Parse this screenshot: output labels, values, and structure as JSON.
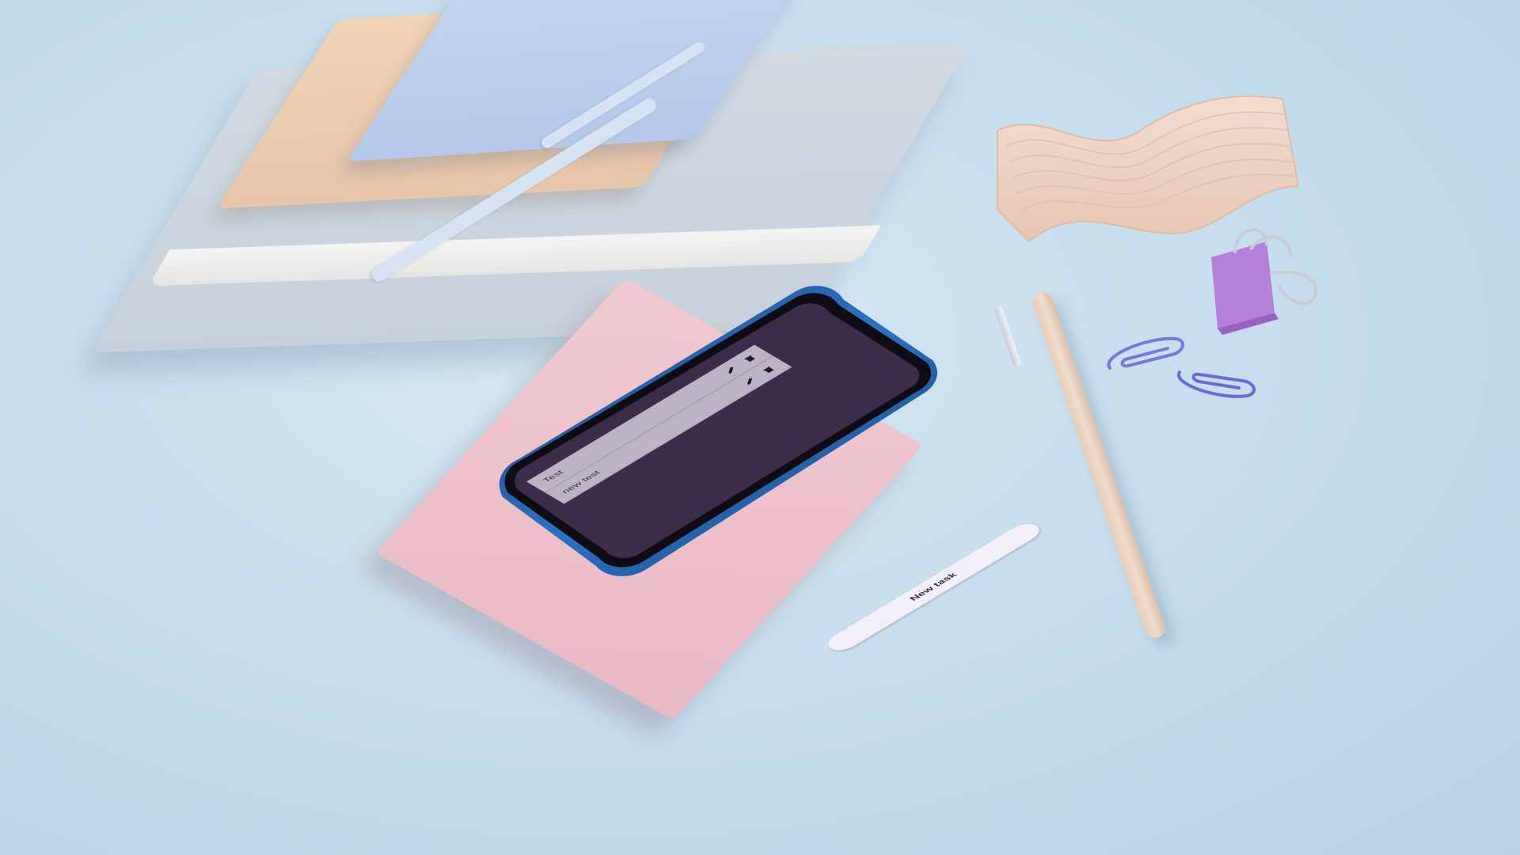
{
  "app": {
    "tasks": [
      {
        "title": "Test"
      },
      {
        "title": "new test"
      }
    ],
    "new_task_button": "New task"
  },
  "colors": {
    "screen_background": "#3b2c49",
    "list_row": "#bdb3c7",
    "button": "#f3eff8",
    "button_text": "#3a2b4f"
  },
  "icons": {
    "edit": "pencil-icon",
    "delete": "trash-icon"
  }
}
